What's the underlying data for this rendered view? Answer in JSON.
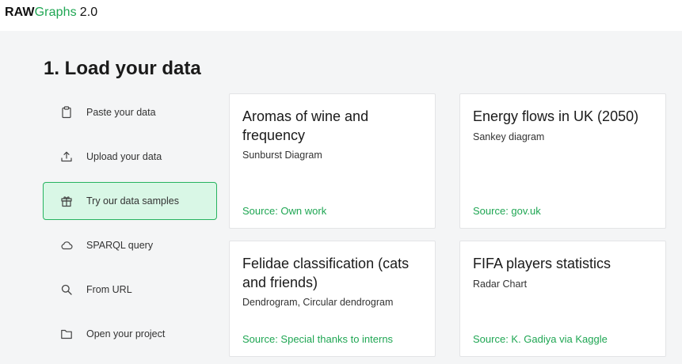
{
  "app": {
    "logo_bold": "RAW",
    "logo_accent": "Graphs",
    "version": "2.0"
  },
  "section": {
    "title": "1. Load your data"
  },
  "sidebar": {
    "items": [
      {
        "label": "Paste your data",
        "icon": "clipboard-icon",
        "active": false
      },
      {
        "label": "Upload your data",
        "icon": "upload-icon",
        "active": false
      },
      {
        "label": "Try our data samples",
        "icon": "gift-icon",
        "active": true
      },
      {
        "label": "SPARQL query",
        "icon": "cloud-icon",
        "active": false
      },
      {
        "label": "From URL",
        "icon": "search-icon",
        "active": false
      },
      {
        "label": "Open your project",
        "icon": "folder-icon",
        "active": false
      }
    ]
  },
  "samples": [
    {
      "title": "Aromas of wine and frequency",
      "chart": "Sunburst Diagram",
      "source": "Source: Own work"
    },
    {
      "title": "Energy flows in UK (2050)",
      "chart": "Sankey diagram",
      "source": "Source: gov.uk"
    },
    {
      "title": "Felidae classification (cats and friends)",
      "chart": "Dendrogram, Circular dendrogram",
      "source": "Source: Special thanks to interns"
    },
    {
      "title": "FIFA players statistics",
      "chart": "Radar Chart",
      "source": "Source: K. Gadiya via Kaggle"
    }
  ],
  "colors": {
    "accent": "#1fa653",
    "active_bg": "#d9f7e6",
    "active_border": "#26b35f",
    "page_bg": "#f4f5f6"
  }
}
